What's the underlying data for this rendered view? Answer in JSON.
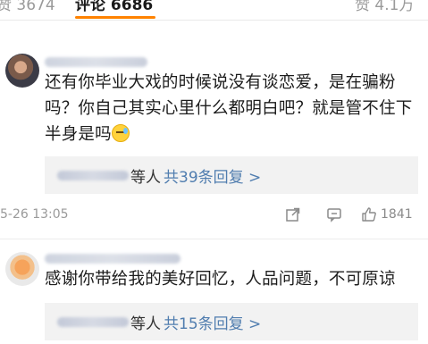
{
  "header": {
    "tabs": [
      {
        "label": "赞 3674"
      },
      {
        "label": "评论 6686"
      },
      {
        "label": "赞 4.1万"
      }
    ]
  },
  "comments": [
    {
      "avatar_icon": "user-avatar-icon",
      "text": "还有你毕业大戏的时候说没有谈恋爱，是在骗粉吗？你自己其实心里什么都明白吧？就是管不住下半身是吗",
      "emoji": "sweat-face-emoji",
      "reply_summary": {
        "people": "等人",
        "count": "共39条回复 >"
      },
      "time": "5-26 13:05",
      "actions": {
        "share_icon": "share-icon",
        "comment_icon": "comment-icon",
        "like_icon": "thumbs-up-icon",
        "likes": "1841"
      }
    },
    {
      "avatar_icon": "user-avatar-icon",
      "text": "感谢你带给我的美好回忆，人品问题，不可原谅",
      "reply_summary": {
        "people": "等人",
        "count": "共15条回复 >"
      }
    }
  ],
  "colors": {
    "accent": "#ff8200",
    "link": "#507daf",
    "muted": "#9a9a9a"
  }
}
